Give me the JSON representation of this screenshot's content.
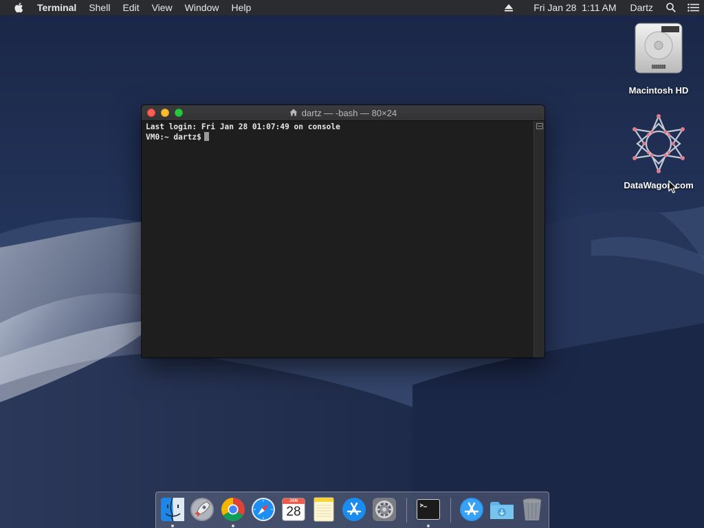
{
  "menubar": {
    "app_name": "Terminal",
    "menus": [
      "Shell",
      "Edit",
      "View",
      "Window",
      "Help"
    ],
    "clock": "Fri Jan 28  1:11 AM",
    "user": "Dartz"
  },
  "desktop": {
    "icons": [
      {
        "label": "Macintosh HD",
        "icon": "hard-drive-icon"
      },
      {
        "label": "DataWagon.com",
        "icon": "star-logo-icon"
      }
    ]
  },
  "terminal": {
    "title": "dartz — -bash — 80×24",
    "lines": [
      "Last login: Fri Jan 28 01:07:49 on console",
      "VM0:~ dartz$"
    ]
  },
  "dock": {
    "calendar_month": "JAN",
    "calendar_day": "28",
    "apps": [
      "finder-icon",
      "launchpad-icon",
      "chrome-icon",
      "safari-icon",
      "calendar-icon",
      "notes-icon",
      "app-store-icon",
      "system-preferences-icon",
      "terminal-icon",
      "applications-folder-icon",
      "downloads-folder-icon",
      "trash-icon"
    ],
    "running": [
      "finder-icon",
      "chrome-icon",
      "terminal-icon"
    ]
  },
  "colors": {
    "menubar": "#2b2c30",
    "terminal_bg": "#1e1e1e",
    "traffic_close": "#ff5f57",
    "traffic_min": "#febc2e",
    "traffic_max": "#28c840",
    "desktop_sky": "#16223f"
  }
}
